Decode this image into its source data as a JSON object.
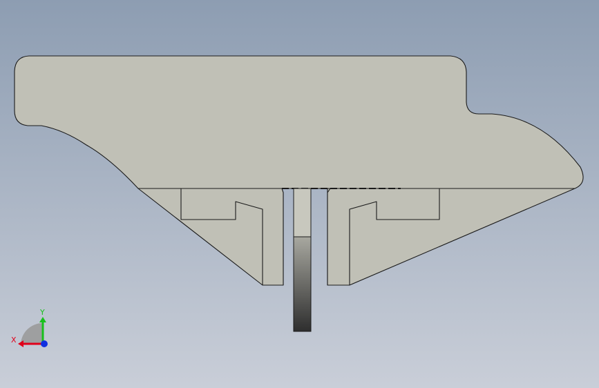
{
  "viewport": {
    "background_top": "#8d9db2",
    "background_bottom": "#c9ced8"
  },
  "model": {
    "face_color": "#c0c0b6",
    "edge_color": "#1a1a1a",
    "pin_top_color": "#c8c8be",
    "pin_gradient_top": "#a8a8a0",
    "pin_gradient_bottom": "#2e2e2e"
  },
  "triad": {
    "x_label": "X",
    "y_label": "Y",
    "x_color": "#e0001a",
    "y_color": "#18c01c",
    "z_color": "#1030e0",
    "plane_color": "#9a9a9a"
  }
}
